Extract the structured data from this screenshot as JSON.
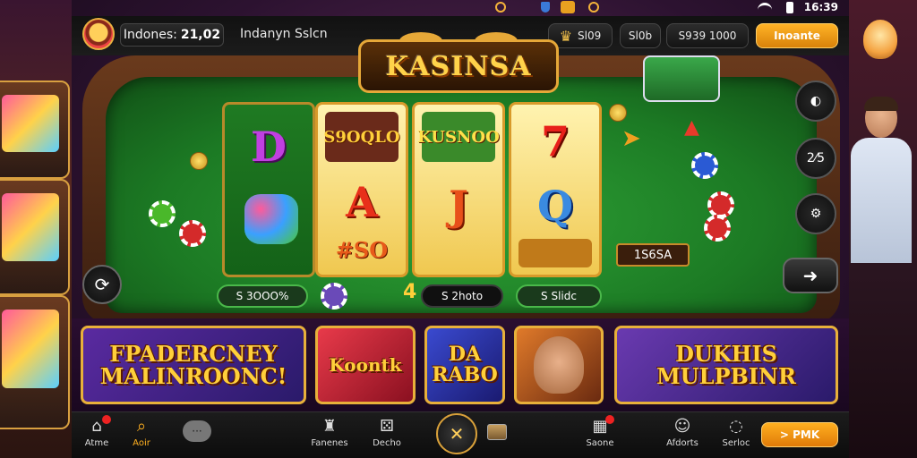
{
  "status_bar": {
    "time": "16:39",
    "icons": [
      "record-icon",
      "shield-icon",
      "game-app-icon",
      "wifi-icon",
      "battery-icon"
    ]
  },
  "header": {
    "user_name": "Indones:",
    "user_value": "21,02",
    "title_text": "Indanyn Sslcn",
    "btn_trophy": "Sl09",
    "btn_2": "Sl0b",
    "btn_3": "S939 1000",
    "btn_cta": "Inoante"
  },
  "logo": {
    "text": "KASINSA"
  },
  "reels": [
    {
      "top": "",
      "mid": "D",
      "bottom": "",
      "style": "green",
      "symbols": [
        "D",
        "clover"
      ]
    },
    {
      "top": "S9OQLO",
      "mid": "A",
      "bottom": "#SO",
      "style": "gold"
    },
    {
      "top": "KUSNOO",
      "mid": "J",
      "bottom": "",
      "style": "gold"
    },
    {
      "top": "7",
      "mid": "Q",
      "bottom": "",
      "style": "gold",
      "tile_label": ""
    }
  ],
  "bets": {
    "left": "S 3OOO%",
    "center": "S 2hoto",
    "center_prefix": "4",
    "right": "S Slidc"
  },
  "table_label": "1S6SA",
  "side_controls": [
    "2⁄5"
  ],
  "games": [
    {
      "label": "FPADERCNEY MALINROONC!",
      "bg": "#5a2a8a"
    },
    {
      "label": "Koontk",
      "bg": "#c8203a"
    },
    {
      "label": "DA RABO",
      "bg": "#2a3aa0"
    },
    {
      "label": "",
      "bg": "#7a3a20"
    },
    {
      "label": "DUKHIS MULPBINR",
      "bg": "#5a3a9a"
    }
  ],
  "nav": {
    "items": [
      {
        "label": "Atme",
        "icon": "home-icon",
        "badge": true
      },
      {
        "label": "Aoir",
        "icon": "search-icon",
        "active": true
      },
      {
        "label": "",
        "icon": "chat-icon"
      },
      {
        "label": "Fanenes",
        "icon": "tower-icon"
      },
      {
        "label": "Decho",
        "icon": "dice-icon"
      },
      {
        "label": "",
        "icon": "cards-icon"
      },
      {
        "label": "Saone",
        "icon": "slot-icon",
        "badge": true
      },
      {
        "label": "Afdorts",
        "icon": "user-icon"
      },
      {
        "label": "Serloc",
        "icon": "message-icon"
      }
    ],
    "cta": "> PMK"
  }
}
